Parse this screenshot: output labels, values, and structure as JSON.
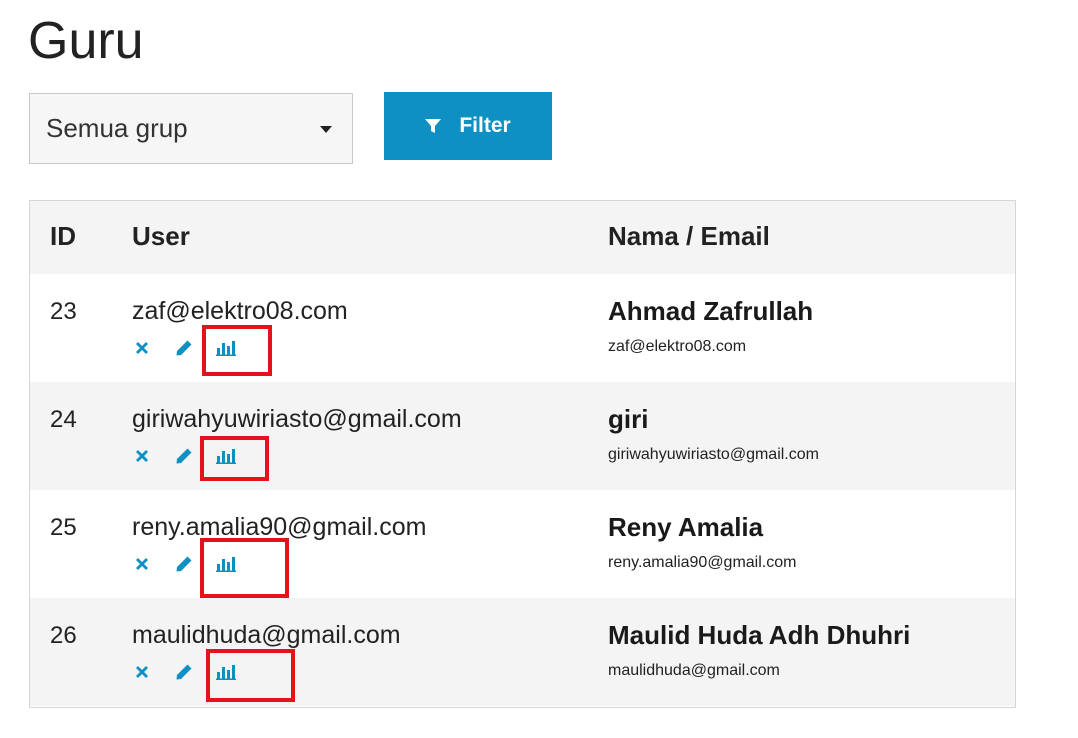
{
  "page": {
    "title": "Guru"
  },
  "filter": {
    "group_select_value": "Semua grup",
    "filter_button_label": "Filter"
  },
  "table": {
    "headers": {
      "id": "ID",
      "user": "User",
      "name_email": "Nama / Email"
    },
    "rows": [
      {
        "id": "23",
        "user": "zaf@elektro08.com",
        "name": "Ahmad Zafrullah",
        "email": "zaf@elektro08.com"
      },
      {
        "id": "24",
        "user": "giriwahyuwiriasto@gmail.com",
        "name": "giri",
        "email": "giriwahyuwiriasto@gmail.com"
      },
      {
        "id": "25",
        "user": "reny.amalia90@gmail.com",
        "name": "Reny Amalia",
        "email": "reny.amalia90@gmail.com"
      },
      {
        "id": "26",
        "user": "maulidhuda@gmail.com",
        "name": "Maulid Huda Adh Dhuhri",
        "email": "maulidhuda@gmail.com"
      }
    ],
    "row_actions": [
      "delete-icon",
      "edit-icon",
      "stats-icon"
    ]
  },
  "colors": {
    "accent": "#0f90c3",
    "highlight": "#e3121b",
    "stripe": "#f4f4f4"
  }
}
